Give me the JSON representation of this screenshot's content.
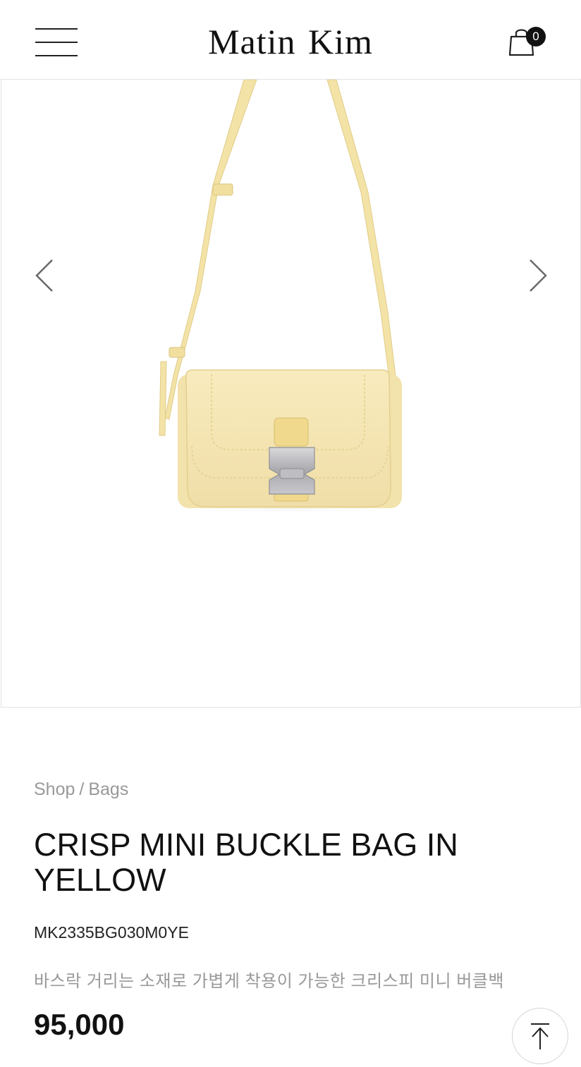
{
  "header": {
    "brand": "Matin Kim",
    "cart_count": "0"
  },
  "breadcrumb": {
    "shop": "Shop",
    "separator": "/",
    "category": "Bags"
  },
  "product": {
    "title": "CRISP MINI BUCKLE BAG IN YELLOW",
    "sku": "MK2335BG030M0YE",
    "description": "바스락 거리는 소재로 가볍게 착용이 가능한 크리스피 미니 버클백",
    "price": "95,000",
    "image_color": "#f5e6b2"
  },
  "icons": {
    "menu": "hamburger-menu-icon",
    "cart": "shopping-bag-icon",
    "prev": "chevron-left-icon",
    "next": "chevron-right-icon",
    "top": "arrow-up-icon"
  }
}
